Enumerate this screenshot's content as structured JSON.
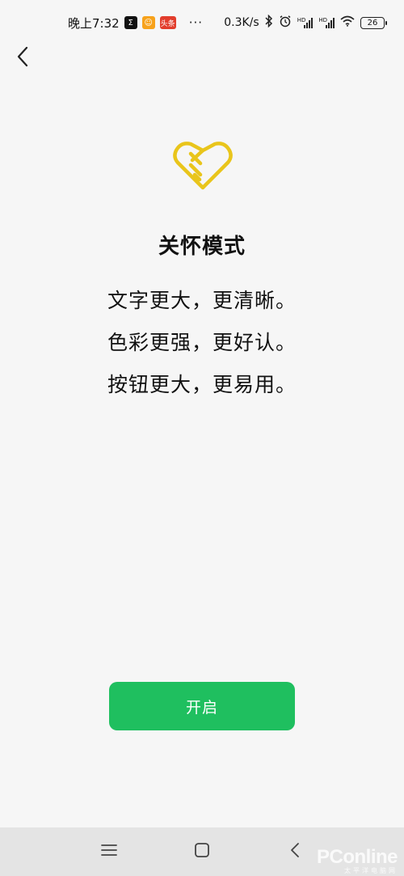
{
  "status_bar": {
    "time": "晚上7:32",
    "app_badges": [
      {
        "text": "Σ",
        "icon": "sigma-app-icon"
      },
      {
        "text": "☺",
        "icon": "face-app-icon"
      },
      {
        "text": "头条",
        "icon": "toutiao-app-icon"
      }
    ],
    "more": "···",
    "net_speed": "0.3K/s",
    "hd_label": "HD",
    "battery": "26"
  },
  "header": {
    "back_icon": "chevron-left-icon"
  },
  "hero": {
    "icon": "heart-hand-icon",
    "title": "关怀模式",
    "features": [
      "文字更大，更清晰。",
      "色彩更强，更好认。",
      "按钮更大，更易用。"
    ]
  },
  "actions": {
    "enable_label": "开启"
  },
  "nav_bar": {
    "menu_icon": "menu-icon",
    "home_icon": "home-square-icon",
    "back_icon": "back-triangle-icon"
  },
  "watermark": {
    "main": "PConline",
    "sub": "太平洋电脑网"
  },
  "colors": {
    "background": "#f6f6f6",
    "accent_green": "#1fbf5f",
    "icon_gold": "#e9c51b",
    "nav_bar": "#e4e4e4",
    "text": "#111111"
  }
}
